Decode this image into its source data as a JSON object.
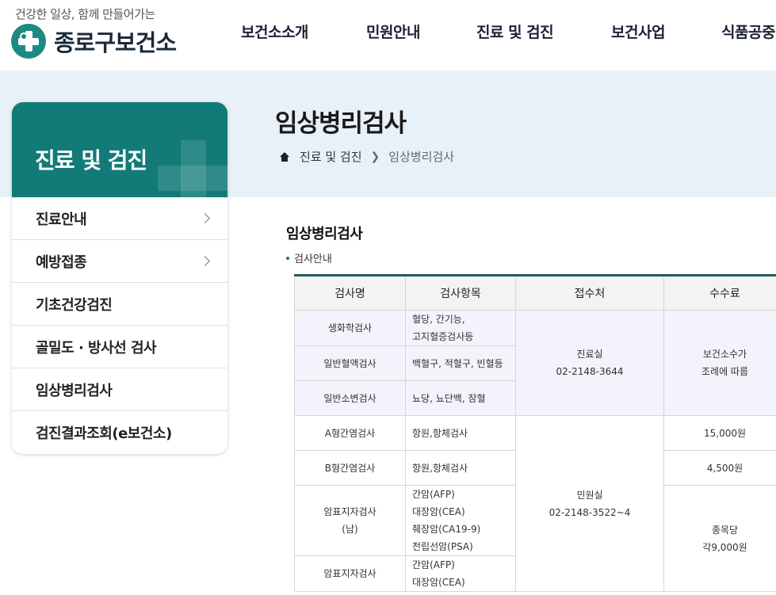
{
  "header": {
    "slogan": "건강한 일상, 함께 만들어가는",
    "logo_text": "종로구보건소",
    "nav": [
      "보건소소개",
      "민원안내",
      "진료 및 검진",
      "보건사업",
      "식품공중"
    ]
  },
  "page": {
    "title": "임상병리검사",
    "breadcrumb": [
      "진료 및 검진",
      "임상병리검사"
    ]
  },
  "sidebar": {
    "title": "진료 및 검진",
    "items": [
      {
        "label": "진료안내",
        "has_arrow": true
      },
      {
        "label": "예방접종",
        "has_arrow": true
      },
      {
        "label": "기초건강검진",
        "has_arrow": false
      },
      {
        "label": "골밀도 · 방사선 검사",
        "has_arrow": false
      },
      {
        "label": "임상병리검사",
        "has_arrow": false
      },
      {
        "label": "검진결과조회(e보건소)",
        "has_arrow": false
      }
    ]
  },
  "content": {
    "section_title": "임상병리검사",
    "sub_title": "검사안내",
    "table": {
      "headers": [
        "검사명",
        "검사항목",
        "접수처",
        "수수료"
      ],
      "rows": [
        {
          "name": "생화학검사",
          "items": [
            "혈당, 간기능,",
            "고지혈증검사등"
          ]
        },
        {
          "name": "일반혈액검사",
          "items": [
            "백혈구, 적혈구, 빈혈등"
          ]
        },
        {
          "name": "일반소변검사",
          "items": [
            "뇨당, 뇨단백, 잠혈"
          ]
        },
        {
          "name": "A형간염검사",
          "items": [
            "항원,항체검사"
          ]
        },
        {
          "name": "B형간염검사",
          "items": [
            "항원,항체검사"
          ]
        },
        {
          "name": "암표지자검사",
          "name2": "(남)",
          "items": [
            "간암(AFP)",
            "대장암(CEA)",
            "췌장암(CA19-9)",
            "전립선암(PSA)"
          ]
        },
        {
          "name": "암표지자검사",
          "items": [
            "간암(AFP)",
            "대장암(CEA)"
          ]
        }
      ],
      "reception": [
        {
          "line1": "진료실",
          "line2": "02-2148-3644"
        },
        {
          "line1": "민원실",
          "line2": "02-2148-3522~4"
        }
      ],
      "fees": [
        {
          "line1": "보건소수가",
          "line2": "조례에 따름"
        },
        {
          "line1": "15,000원"
        },
        {
          "line1": "4,500원"
        },
        {
          "line1": "종목당",
          "line2": "각9,000원"
        }
      ]
    }
  }
}
